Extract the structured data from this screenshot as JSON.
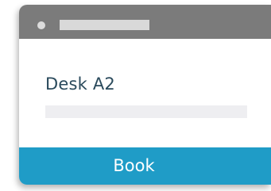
{
  "card": {
    "title": "Desk A2",
    "book_label": "Book"
  },
  "colors": {
    "titlebar": "#7b7b7b",
    "title_text": "#2a4a5c",
    "button": "#1f9cc7",
    "button_text": "#ffffff",
    "placeholder": "#eeeef1"
  },
  "icons": {
    "window_dot": "window-dot-icon"
  }
}
